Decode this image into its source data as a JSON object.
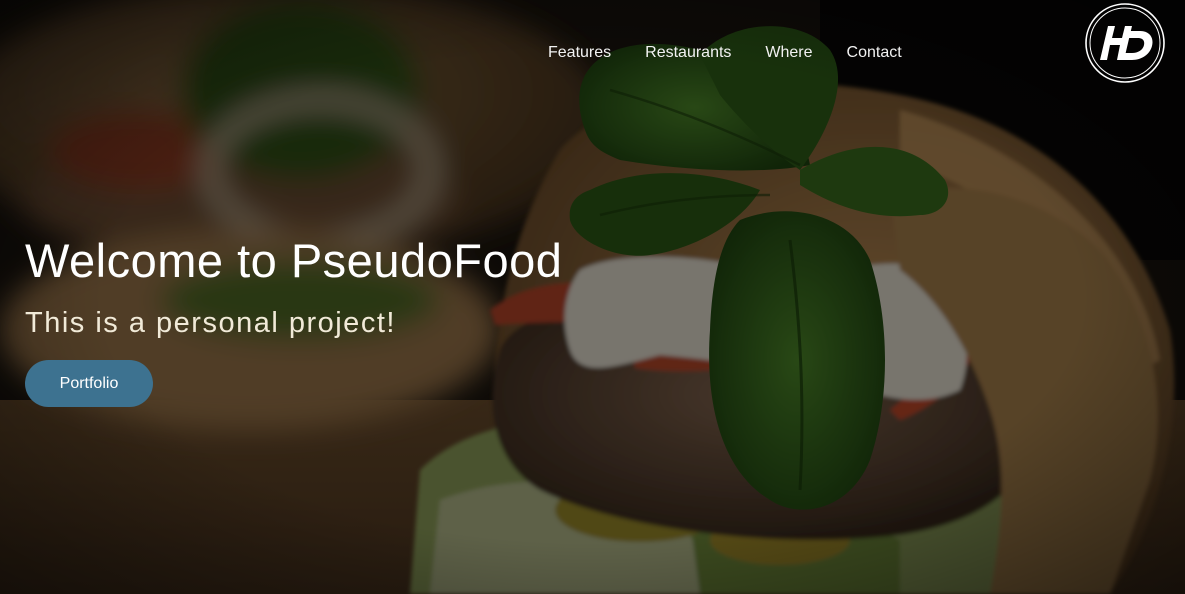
{
  "nav": {
    "items": [
      {
        "label": "Features"
      },
      {
        "label": "Restaurants"
      },
      {
        "label": "Where"
      },
      {
        "label": "Contact"
      }
    ]
  },
  "logo": {
    "icon": "hd-logo-icon",
    "text": "HD"
  },
  "hero": {
    "title": "Welcome to PseudoFood",
    "subtitle": "This is a personal project!",
    "button_label": "Portfolio"
  },
  "colors": {
    "button_bg": "#3d7290",
    "text": "#ffffff",
    "overlay": "#000000"
  }
}
